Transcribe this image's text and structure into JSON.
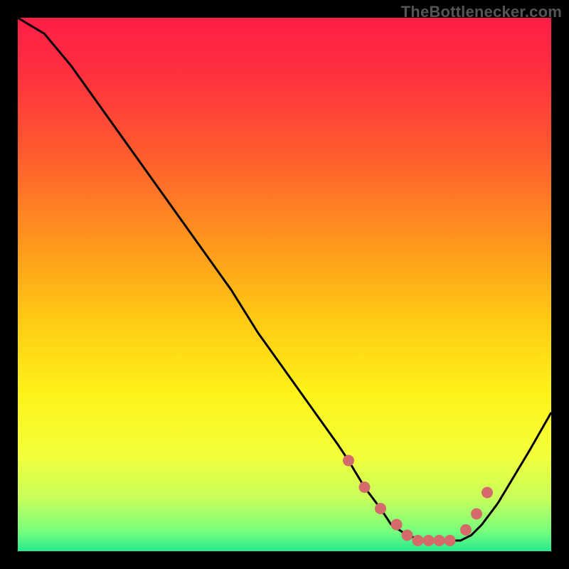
{
  "watermark": "TheBottlenecker.com",
  "chart_data": {
    "type": "line",
    "title": "",
    "xlabel": "",
    "ylabel": "",
    "xlim": [
      0,
      100
    ],
    "ylim": [
      0,
      100
    ],
    "series": [
      {
        "name": "curve",
        "color": "#000000",
        "x": [
          0,
          5,
          10,
          15,
          20,
          25,
          30,
          35,
          40,
          45,
          50,
          55,
          60,
          62,
          65,
          68,
          70,
          73,
          76,
          79,
          81,
          83,
          85,
          87,
          90,
          93,
          96,
          100
        ],
        "y": [
          100,
          97,
          91,
          84,
          77,
          70,
          63,
          56,
          49,
          41,
          34,
          27,
          20,
          17,
          12,
          8,
          5,
          3,
          2,
          2,
          2,
          2,
          3,
          5,
          9,
          14,
          19,
          26
        ]
      }
    ],
    "points": {
      "name": "markers",
      "color": "#d46a6a",
      "x": [
        62,
        65,
        68,
        71,
        73,
        75,
        77,
        79,
        81,
        84,
        86,
        88
      ],
      "y": [
        17,
        12,
        8,
        5,
        3,
        2,
        2,
        2,
        2,
        4,
        7,
        11
      ]
    },
    "gradient_stops": [
      {
        "offset": 0.0,
        "color": "#ff1e46"
      },
      {
        "offset": 0.1,
        "color": "#ff2f3f"
      },
      {
        "offset": 0.25,
        "color": "#ff5a2f"
      },
      {
        "offset": 0.4,
        "color": "#ff8f1f"
      },
      {
        "offset": 0.55,
        "color": "#ffc414"
      },
      {
        "offset": 0.7,
        "color": "#fff218"
      },
      {
        "offset": 0.82,
        "color": "#f3ff3a"
      },
      {
        "offset": 0.9,
        "color": "#c9ff5c"
      },
      {
        "offset": 0.96,
        "color": "#7bff7b"
      },
      {
        "offset": 1.0,
        "color": "#28e88c"
      }
    ]
  }
}
